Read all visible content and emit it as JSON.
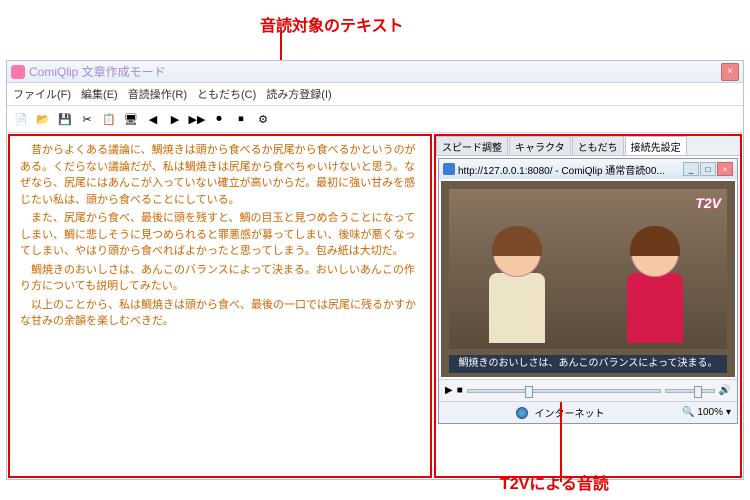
{
  "annotations": {
    "top": "音読対象のテキスト",
    "bottom": "T2Vによる音読"
  },
  "window": {
    "title": "ComiQlip 文章作成モード"
  },
  "menu": {
    "file": "ファイル(F)",
    "edit": "編集(E)",
    "readop": "音読操作(R)",
    "friends": "ともだち(C)",
    "readreg": "読み方登録(I)"
  },
  "text_body": {
    "p1": "昔からよくある議論に、鯛焼きは頭から食べるか尻尾から食べるかというのがある。くだらない議論だが、私は鯛焼きは尻尾から食べちゃいけないと思う。なぜなら、尻尾にはあんこが入っていない確立が高いからだ。最初に強い甘みを感じたい私は、頭から食べることにしている。",
    "p2": "また、尻尾から食べ、最後に頭を残すと、鯛の目玉と見つめ合うことになってしまい、鯛に悲しそうに見つめられると罪悪感が募ってしまい、後味が悪くなってしまい、やはり頭から食べればよかったと思ってしまう。包み紙は大切だ。",
    "p3": "鯛焼きのおいしさは、あんこのバランスによって決まる。おいしいあんこの作り方についても説明してみたい。",
    "p4": "以上のことから、私は鯛焼きは頭から食べ、最後の一口では尻尾に残るかすかな甘みの余韻を楽しむべきだ。"
  },
  "tabs": {
    "speed": "スピード調整",
    "character": "キャラクタ",
    "friends": "ともだち",
    "connection": "接続先設定"
  },
  "ie": {
    "url_title": "http://127.0.0.1:8080/ - ComiQlip 通常音読00...",
    "logo": "T2V",
    "caption": "鯛焼きのおいしさは、あんこのバランスによって決まる。"
  },
  "status": {
    "internet": "インターネット",
    "zoom": "100%"
  },
  "icons": {
    "play": "▶",
    "stop": "■",
    "vol": "🔊"
  }
}
